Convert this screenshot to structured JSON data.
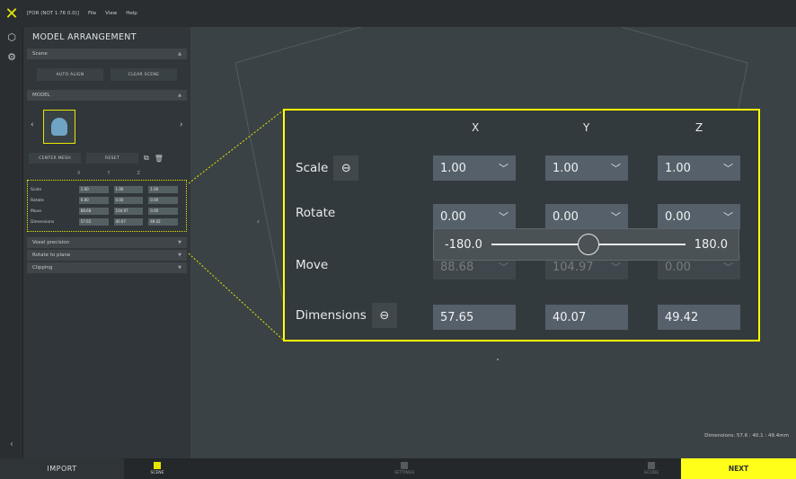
{
  "menubar": {
    "app_tag": "[FOR (NOT 1.76 0.0)]",
    "items": [
      "File",
      "View",
      "Help"
    ]
  },
  "panel": {
    "title": "MODEL ARRANGEMENT",
    "scene_section": "Scene",
    "auto_align": "AUTO ALIGN",
    "clear_scene": "CLEAR SCENE",
    "model_section": "MODEL",
    "center_mesh": "CENTER MESH",
    "reset": "RESET",
    "axes": [
      "X",
      "Y",
      "Z"
    ],
    "mini_rows": [
      {
        "label": "Scale",
        "values": [
          "1.00",
          "1.00",
          "1.00"
        ]
      },
      {
        "label": "Rotate",
        "values": [
          "0.00",
          "0.00",
          "0.00"
        ]
      },
      {
        "label": "Move",
        "values": [
          "88.68",
          "104.97",
          "0.00"
        ]
      },
      {
        "label": "Dimensions",
        "values": [
          "57.65",
          "40.07",
          "49.42"
        ]
      }
    ],
    "voxel_precision": "Voxel precision",
    "rotate_to_plane": "Rotate to plane",
    "clipping": "Clipping"
  },
  "viewport": {
    "dimensions_readout": "Dimensions: 57.6 : 40.1 : 49.4mm",
    "axis_marker": "z"
  },
  "bottombar": {
    "import": "IMPORT",
    "steps": [
      "SCENE",
      "SETTINGS",
      "GCODE"
    ],
    "next": "NEXT"
  },
  "zoom": {
    "headers": [
      "X",
      "Y",
      "Z"
    ],
    "scale_label": "Scale",
    "rotate_label": "Rotate",
    "move_label": "Move",
    "dimensions_label": "Dimensions",
    "scale": [
      "1.00",
      "1.00",
      "1.00"
    ],
    "rotate": [
      "0.00",
      "0.00",
      "0.00"
    ],
    "move": [
      "88.68",
      "104.97",
      "0.00"
    ],
    "dimensions": [
      "57.65",
      "40.07",
      "49.42"
    ],
    "slider_min": "-180.0",
    "slider_max": "180.0",
    "slider_value_fraction": 0.5
  },
  "colors": {
    "accent": "#ffff00",
    "panel": "#30363a",
    "viewport": "#3b4245"
  }
}
